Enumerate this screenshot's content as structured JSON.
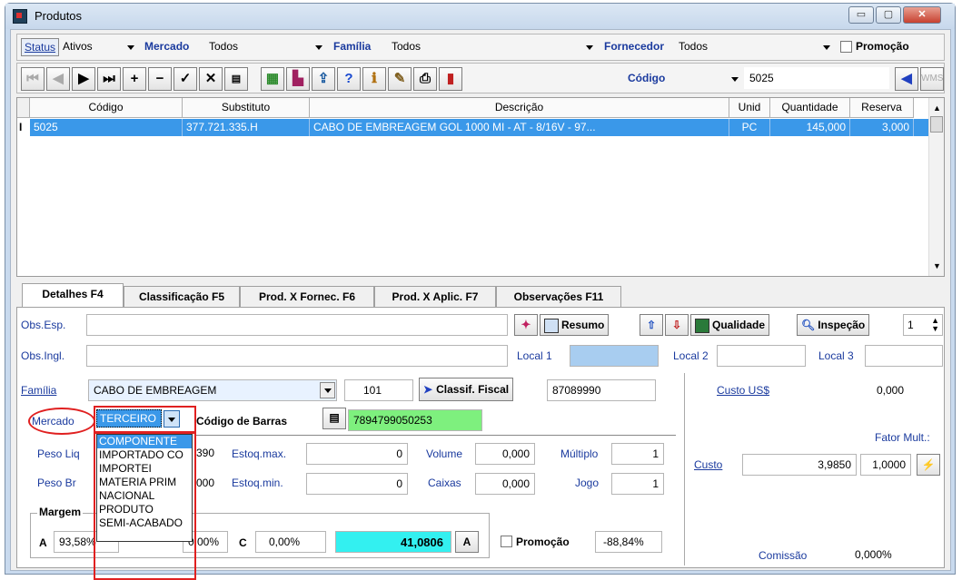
{
  "window": {
    "title": "Produtos",
    "minimize": "▭",
    "maximize": "▢",
    "close": "✕"
  },
  "filters": {
    "status_label": "Status",
    "status_value": "Ativos",
    "mercado_label": "Mercado",
    "mercado_value": "Todos",
    "familia_label": "Família",
    "familia_value": "Todos",
    "fornecedor_label": "Fornecedor",
    "fornecedor_value": "Todos",
    "promocao_label": "Promoção"
  },
  "toolbar": {
    "search_field_label": "Código",
    "search_value": "5025",
    "wms_label": "WMS"
  },
  "grid": {
    "columns": [
      "Código",
      "Substituto",
      "Descrição",
      "Unid",
      "Quantidade",
      "Reserva"
    ],
    "row": {
      "indicator": "I",
      "codigo": "5025",
      "substituto": "377.721.335.H",
      "descricao": "CABO DE EMBREAGEM GOL 1000 MI - AT - 8/16V - 97...",
      "unid": "PC",
      "quantidade": "145,000",
      "reserva": "3,000"
    }
  },
  "tabs": [
    "Detalhes F4",
    "Classificação F5",
    "Prod. X Fornec. F6",
    "Prod. X Aplic. F7",
    "Observações F11"
  ],
  "detalhes": {
    "obs_esp_label": "Obs.Esp.",
    "obs_ingl_label": "Obs.Ingl.",
    "resumo_label": "Resumo",
    "qualidade_label": "Qualidade",
    "inspecao_label": "Inspeção",
    "inspecao_count": "1",
    "local1_label": "Local 1",
    "local2_label": "Local 2",
    "local3_label": "Local 3",
    "familia_label": "Família",
    "familia_value": "CABO DE EMBREAGEM",
    "familia_code": "101",
    "classif_label": "Classif. Fiscal",
    "classif_value": "87089990",
    "mercado_label": "Mercado",
    "mercado_value": "TERCEIRO",
    "barcode_label": "Código de Barras",
    "barcode_value": "7894799050253",
    "peso_liq_label": "Peso Liq",
    "peso_liq_value": "390",
    "peso_br_label": "Peso Br",
    "peso_br_value": "000",
    "estoq_max_label": "Estoq.max.",
    "estoq_max_value": "0",
    "estoq_min_label": "Estoq.min.",
    "estoq_min_value": "0",
    "volume_label": "Volume",
    "volume_value": "0,000",
    "caixas_label": "Caixas",
    "caixas_value": "0,000",
    "multiplo_label": "Múltiplo",
    "multiplo_value": "1",
    "jogo_label": "Jogo",
    "jogo_value": "1",
    "margem_label": "Margem",
    "a_label": "A",
    "a_value": "93,58%",
    "b_value": "0,00%",
    "c_label": "C",
    "c_value": "0,00%",
    "preco_value": "41,0806",
    "a_button": "A",
    "promocao_label": "Promoção",
    "promocao_value": "-88,84%",
    "custo_us_label": "Custo US$",
    "custo_us_value": "0,000",
    "fator_label": "Fator Mult.:",
    "custo_label": "Custo",
    "custo_value": "3,9850",
    "fator_value": "1,0000",
    "comissao_label": "Comissão",
    "comissao_value": "0,000%"
  },
  "mercado_options": [
    "COMPONENTE",
    "IMPORTADO CO",
    "IMPORTEI",
    "MATERIA PRIM",
    "NACIONAL",
    "PRODUTO",
    "SEMI-ACABADO"
  ]
}
